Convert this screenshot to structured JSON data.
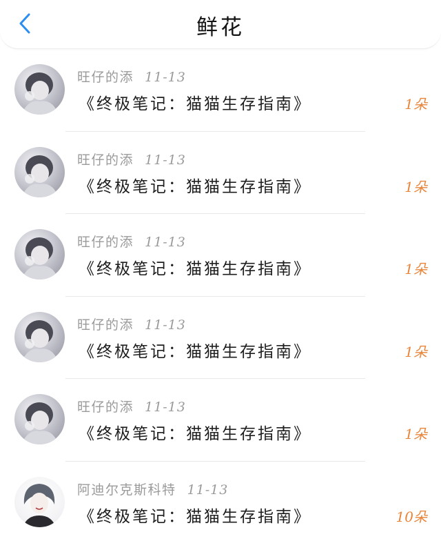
{
  "header": {
    "title": "鲜花"
  },
  "accent_color": "#2b8df0",
  "count_color": "#e8853a",
  "rows": [
    {
      "user": "旺仔的添",
      "date": "11-13",
      "book": "《终极笔记：猫猫生存指南》",
      "count": "1朵",
      "avatar": "avatar-image"
    },
    {
      "user": "旺仔的添",
      "date": "11-13",
      "book": "《终极笔记：猫猫生存指南》",
      "count": "1朵",
      "avatar": "avatar-image"
    },
    {
      "user": "旺仔的添",
      "date": "11-13",
      "book": "《终极笔记：猫猫生存指南》",
      "count": "1朵",
      "avatar": "avatar-image"
    },
    {
      "user": "旺仔的添",
      "date": "11-13",
      "book": "《终极笔记：猫猫生存指南》",
      "count": "1朵",
      "avatar": "avatar-image"
    },
    {
      "user": "旺仔的添",
      "date": "11-13",
      "book": "《终极笔记：猫猫生存指南》",
      "count": "1朵",
      "avatar": "avatar-image"
    },
    {
      "user": "阿迪尔克斯科特",
      "date": "11-13",
      "book": "《终极笔记：猫猫生存指南》",
      "count": "10朵",
      "avatar": "avatar-image"
    }
  ]
}
